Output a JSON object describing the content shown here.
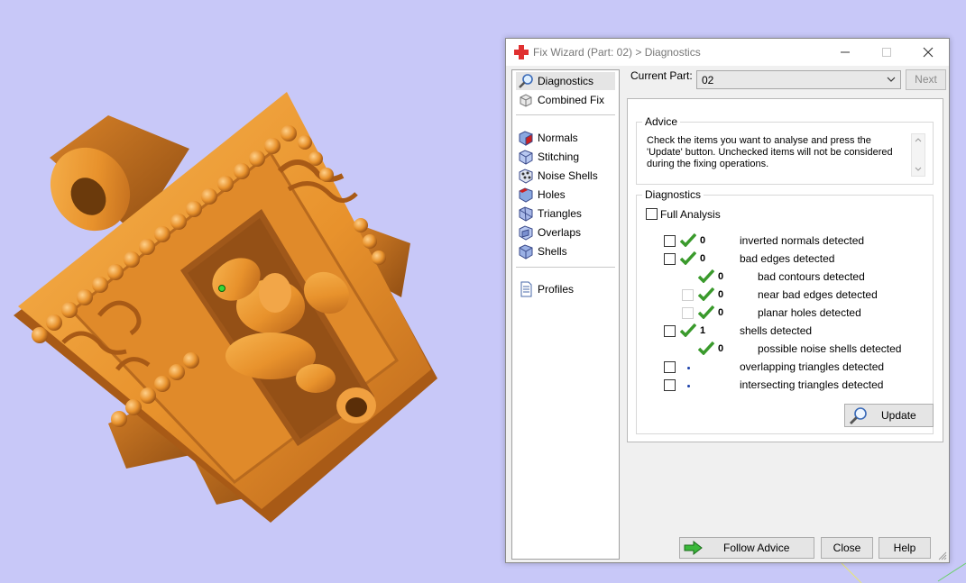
{
  "window": {
    "title": "Fix Wizard (Part: 02) > Diagnostics",
    "icon": "red-cross-icon",
    "controls": [
      "minimize-icon",
      "maximize-icon",
      "close-icon"
    ]
  },
  "nav": {
    "items": [
      {
        "label": "Diagnostics",
        "icon": "magnifier-icon",
        "selected": true
      },
      {
        "label": "Combined Fix",
        "icon": "cube-icon"
      },
      {
        "label": "Normals",
        "icon": "normals-cube-icon"
      },
      {
        "label": "Stitching",
        "icon": "stitching-cube-icon"
      },
      {
        "label": "Noise Shells",
        "icon": "noise-shells-icon"
      },
      {
        "label": "Holes",
        "icon": "holes-cube-icon"
      },
      {
        "label": "Triangles",
        "icon": "triangles-cube-icon"
      },
      {
        "label": "Overlaps",
        "icon": "overlaps-cube-icon"
      },
      {
        "label": "Shells",
        "icon": "shells-cube-icon"
      },
      {
        "label": "Profiles",
        "icon": "document-icon"
      }
    ]
  },
  "current_part": {
    "label": "Current Part:",
    "value": "02"
  },
  "next_label": "Next",
  "advice": {
    "title": "Advice",
    "text": "Check the items you want to analyse and press the 'Update' button. Unchecked items will not be considered during the fixing operations."
  },
  "diagnostics": {
    "title": "Diagnostics",
    "full_analysis": "Full Analysis",
    "rows": [
      {
        "label": "inverted normals detected",
        "value": "0",
        "status": "ok",
        "checked": false
      },
      {
        "label": "bad edges detected",
        "value": "0",
        "status": "ok",
        "checked": false
      },
      {
        "label": "bad contours detected",
        "value": "0",
        "status": "ok"
      },
      {
        "label": "near bad edges detected",
        "value": "0",
        "status": "ok",
        "checked": false
      },
      {
        "label": "planar holes detected",
        "value": "0",
        "status": "ok",
        "checked": false
      },
      {
        "label": "shells detected",
        "value": "1",
        "status": "ok",
        "checked": false
      },
      {
        "label": "possible noise shells detected",
        "value": "0",
        "status": "ok"
      },
      {
        "label": "overlapping triangles detected",
        "value": "",
        "status": "pending",
        "checked": false
      },
      {
        "label": "intersecting triangles detected",
        "value": "",
        "status": "pending",
        "checked": false
      }
    ],
    "update_label": "Update"
  },
  "buttons": {
    "follow_advice": "Follow Advice",
    "close": "Close",
    "help": "Help"
  },
  "colors": {
    "viewport_bg": "#c8c8f8",
    "model": "#e8962e",
    "check": "#3a9a2c",
    "title_icon": "#e03030"
  }
}
